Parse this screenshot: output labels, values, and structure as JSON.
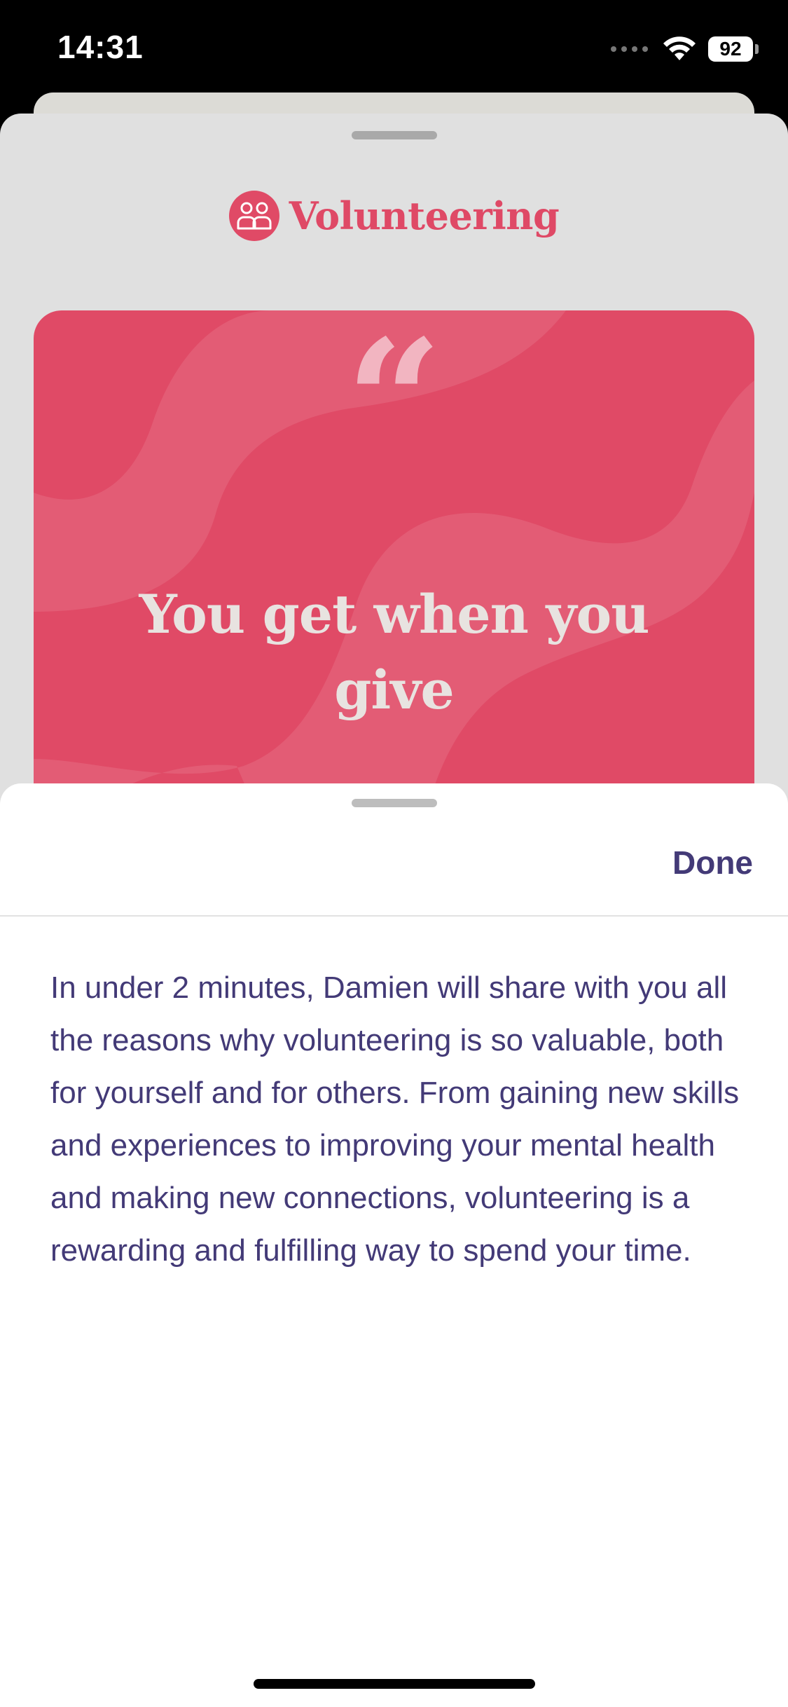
{
  "status_bar": {
    "time": "14:31",
    "battery": "92",
    "icons": [
      "signal-dots-icon",
      "wifi-icon",
      "battery-icon"
    ]
  },
  "module": {
    "category_icon": "people-icon",
    "category": "Volunteering",
    "quote_mark": "“",
    "quote": "You get when you give"
  },
  "sheet": {
    "done_label": "Done",
    "description": "In under 2 minutes, Damien will share with you all the reasons why volunteering is so valuable, both for yourself and for others. From gaining new skills and experiences to improving your mental health and making new connections, volunteering is a rewarding and fulfilling way to spend your time."
  },
  "colors": {
    "accent": "#e04a66",
    "text": "#433a77",
    "dim_background": "#e0e0e0"
  }
}
